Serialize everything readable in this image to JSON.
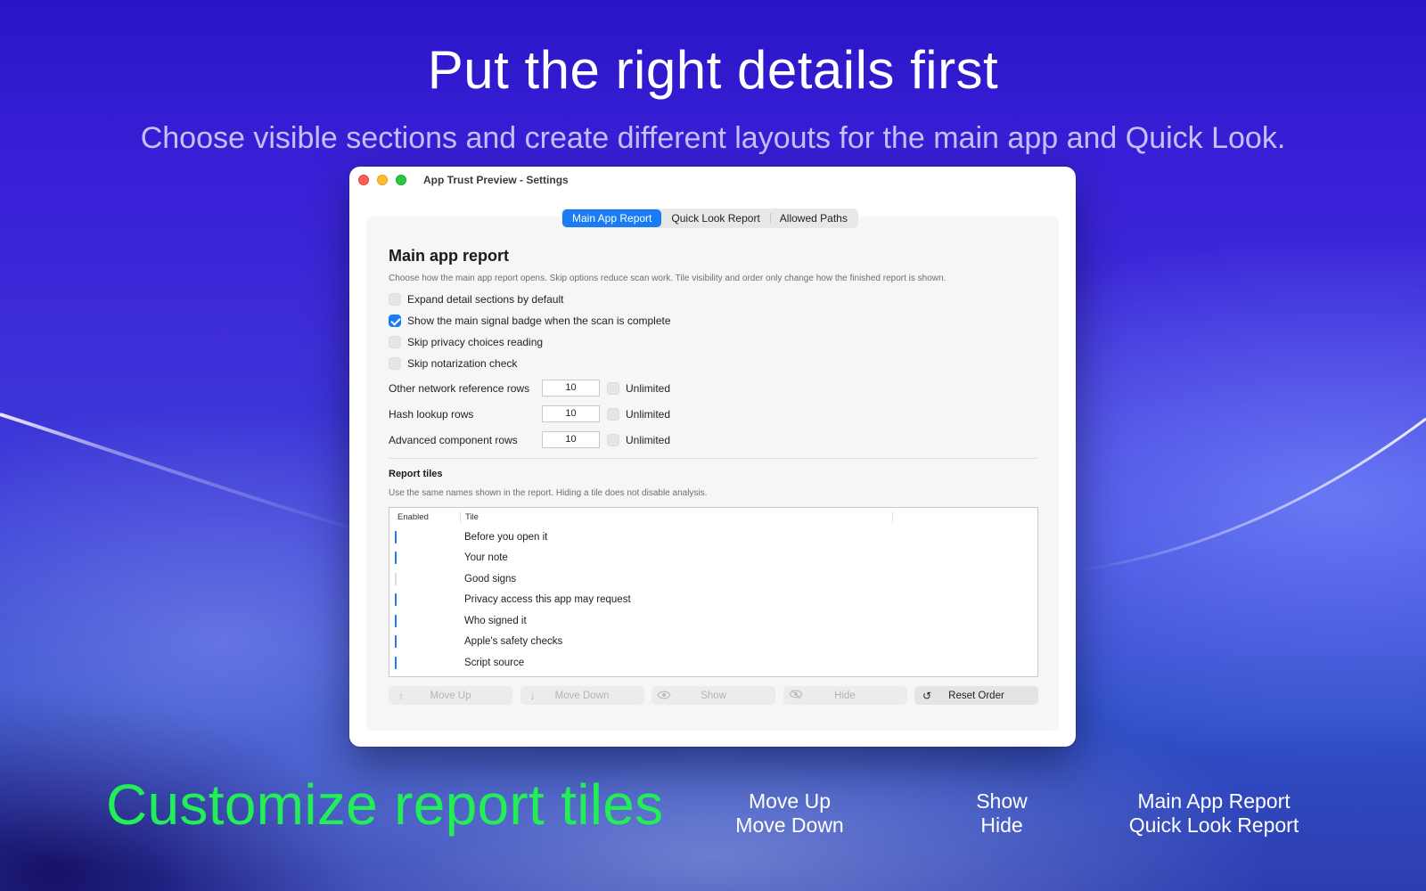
{
  "hero": {
    "headline": "Put the right details first",
    "subhead": "Choose visible sections and create different layouts for the main app and Quick Look."
  },
  "window": {
    "title": "App Trust Preview - Settings",
    "tabs": [
      {
        "label": "Main App Report",
        "active": true
      },
      {
        "label": "Quick Look Report",
        "active": false
      },
      {
        "label": "Allowed Paths",
        "active": false
      }
    ],
    "section_title": "Main app report",
    "section_desc": "Choose how the main app report opens. Skip options reduce scan work. Tile visibility and order only change how the finished report is shown.",
    "options": [
      {
        "label": "Expand detail sections by default",
        "checked": false
      },
      {
        "label": "Show the main signal badge when the scan is complete",
        "checked": true
      },
      {
        "label": "Skip privacy choices reading",
        "checked": false
      },
      {
        "label": "Skip notarization check",
        "checked": false
      }
    ],
    "limits": [
      {
        "label": "Other network reference rows",
        "value": "10",
        "unlimited_label": "Unlimited"
      },
      {
        "label": "Hash lookup rows",
        "value": "10",
        "unlimited_label": "Unlimited"
      },
      {
        "label": "Advanced component rows",
        "value": "10",
        "unlimited_label": "Unlimited"
      }
    ],
    "tiles_title": "Report tiles",
    "tiles_desc": "Use the same names shown in the report. Hiding a tile does not disable analysis.",
    "table_headers": {
      "enabled": "Enabled",
      "tile": "Tile"
    },
    "tiles": [
      {
        "name": "Before you open it",
        "enabled": true
      },
      {
        "name": "Your note",
        "enabled": true
      },
      {
        "name": "Good signs",
        "enabled": false
      },
      {
        "name": "Privacy access this app may request",
        "enabled": true
      },
      {
        "name": "Who signed it",
        "enabled": true
      },
      {
        "name": "Apple's safety checks",
        "enabled": true
      },
      {
        "name": "Script source",
        "enabled": true
      }
    ],
    "actions": {
      "move_up": "Move Up",
      "move_down": "Move Down",
      "show": "Show",
      "hide": "Hide",
      "reset_order": "Reset Order"
    }
  },
  "captions": {
    "green": "Customize report tiles",
    "move": {
      "line1": "Move Up",
      "line2": "Move Down"
    },
    "visibility": {
      "line1": "Show",
      "line2": "Hide"
    },
    "reports": {
      "line1": "Main App Report",
      "line2": "Quick Look Report"
    }
  },
  "colors": {
    "accent": "#1a7cf5",
    "green_caption": "#22ee55"
  }
}
